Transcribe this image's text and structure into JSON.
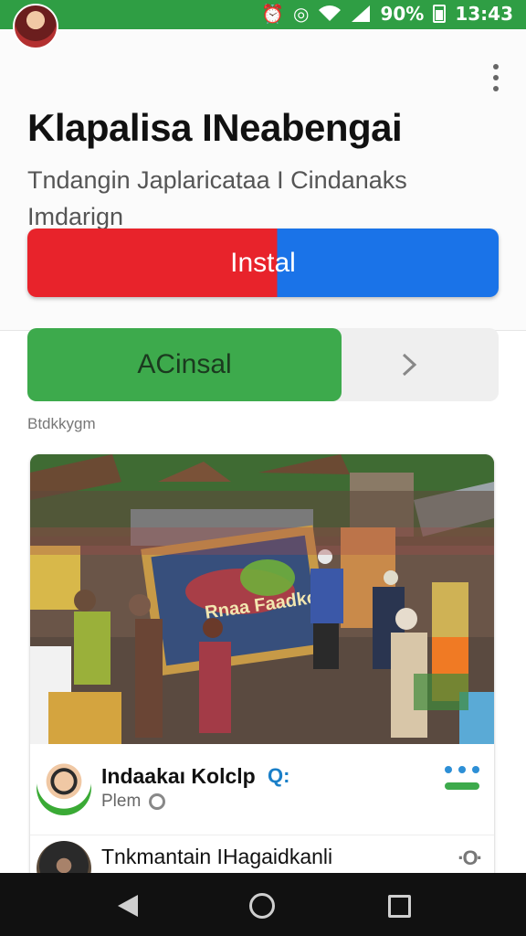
{
  "status_bar": {
    "battery": "90%",
    "time": "13:43",
    "icons": [
      "alarm-icon",
      "timer-icon",
      "wifi-icon",
      "signal-icon",
      "battery-icon"
    ]
  },
  "header": {
    "title": "Klapalisa INeabengai",
    "subtitle": "Tndangin Japlaricataa I Cindanaks Imdarign"
  },
  "actions": {
    "install_label": "Instal",
    "secondary_label": "ACinsal"
  },
  "section_label": "Btdkkygm",
  "post_image_text": "Rnaa Faadko",
  "feed": [
    {
      "name": "Indaakaı Kolclp",
      "meta": "Plem"
    },
    {
      "name": "Tnkmantain IHagaidkanli"
    }
  ],
  "colors": {
    "status_bar": "#2f9e44",
    "install_red": "#e8232b",
    "install_blue": "#1a73e8",
    "secondary_green": "#3daa4c"
  }
}
